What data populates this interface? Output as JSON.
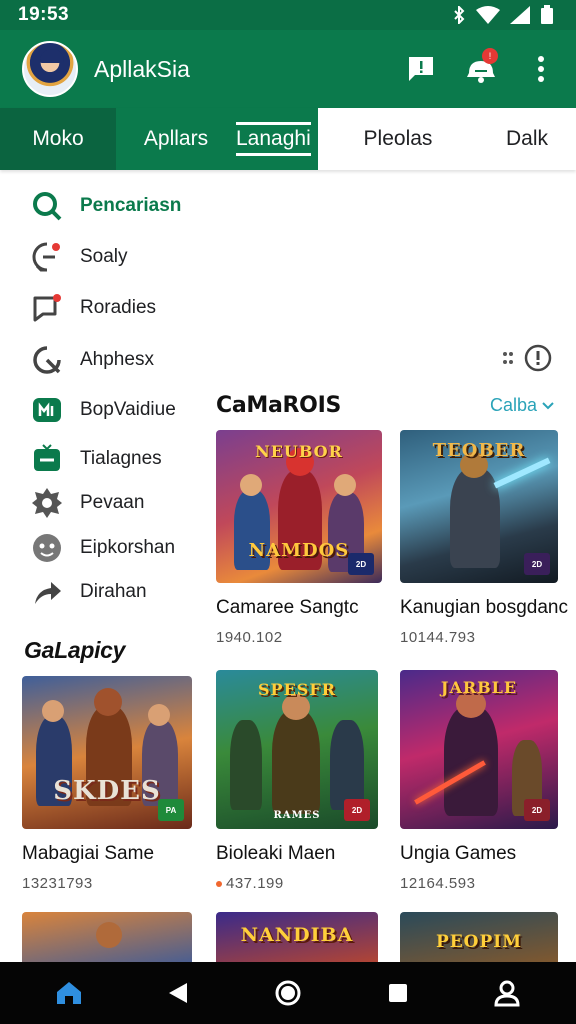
{
  "status": {
    "time": "19:53"
  },
  "app": {
    "title": "ApllakSia"
  },
  "tabs": [
    {
      "label": "Moko"
    },
    {
      "label": "Apllars"
    },
    {
      "label": "Lanaghi"
    },
    {
      "label": "Pleolas"
    },
    {
      "label": "Dalk"
    }
  ],
  "menu": [
    {
      "label": "Pencariasn",
      "icon": "search-icon"
    },
    {
      "label": "Soaly",
      "icon": "chat-icon"
    },
    {
      "label": "Roradies",
      "icon": "message-alert-icon"
    },
    {
      "label": "Ahphesx",
      "icon": "compass-icon"
    },
    {
      "label": "BopVaidiue",
      "icon": "gamepad-icon"
    },
    {
      "label": "Tialagnes",
      "icon": "inbox-icon"
    },
    {
      "label": "Pevaan",
      "icon": "settings-icon"
    },
    {
      "label": "Eipkorshan",
      "icon": "face-icon"
    },
    {
      "label": "Dirahan",
      "icon": "share-icon"
    }
  ],
  "section1": {
    "title": "CaMaROIS",
    "link": "Calba",
    "cards": [
      {
        "title": "Camaree Sangtc",
        "meta": "1940.102",
        "banner": "NEUBOR",
        "banner2": "NAMDOS",
        "corner": "2D"
      },
      {
        "title": "Kanugian bosgdanc",
        "meta": "10144.793",
        "banner": "TEOBER",
        "corner": "2D"
      }
    ]
  },
  "section2": {
    "title": "GaLapicy",
    "cards": [
      {
        "title": "Mabagiai Same",
        "meta": "13231793",
        "banner": "SKDES",
        "corner": "PA"
      },
      {
        "title": "Bioleaki Maen",
        "meta": "437.199",
        "banner": "SPESFR",
        "banner2": "RAMES",
        "corner": "2D"
      },
      {
        "title": "Ungia Games",
        "meta": "12164.593",
        "banner": "JARBLE",
        "corner": "2D"
      }
    ]
  },
  "section3": {
    "cards": [
      {
        "banner": ""
      },
      {
        "banner": "NANDIBA"
      },
      {
        "banner": "PEOPIM"
      }
    ]
  },
  "colors": {
    "primary": "#0b7a4c",
    "accent": "#2aa3b8"
  }
}
